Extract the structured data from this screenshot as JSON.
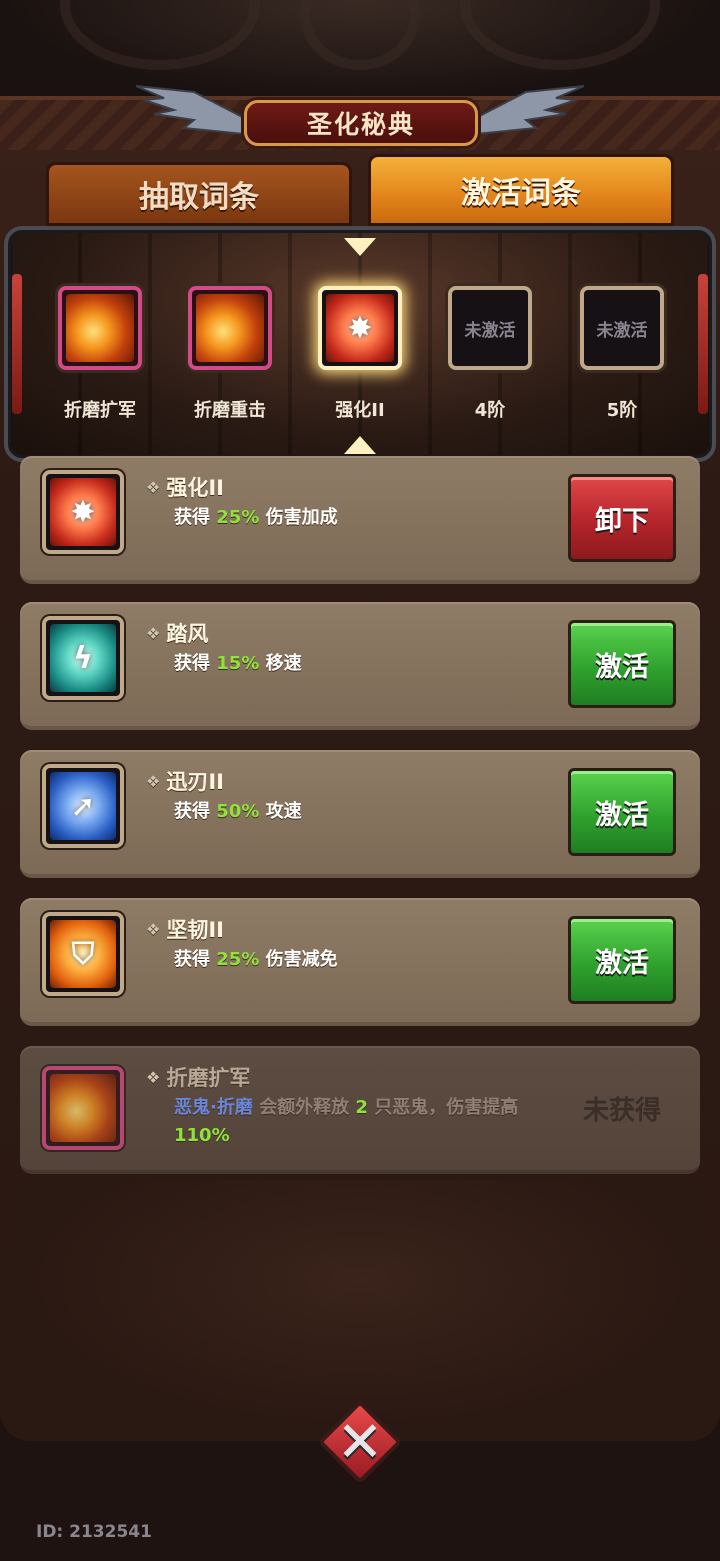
{
  "header": {
    "title": "圣化秘典"
  },
  "tabs": [
    {
      "label": "抽取词条",
      "active": false
    },
    {
      "label": "激活词条",
      "active": true
    }
  ],
  "slots": [
    {
      "label": "折磨扩军",
      "icon": "fire-fist-icon",
      "state": "equipped"
    },
    {
      "label": "折磨重击",
      "icon": "fire-fist-icon",
      "state": "equipped"
    },
    {
      "label": "强化II",
      "icon": "power-burst-icon",
      "state": "selected"
    },
    {
      "label": "4阶",
      "empty_text": "未激活",
      "state": "locked"
    },
    {
      "label": "5阶",
      "empty_text": "未激活",
      "state": "locked"
    }
  ],
  "cards": [
    {
      "name": "强化II",
      "desc_prefix": "获得",
      "value": "25%",
      "desc_suffix": "伤害加成",
      "icon": "power-burst-icon",
      "button": "卸下",
      "button_color": "red"
    },
    {
      "name": "踏风",
      "desc_prefix": "获得",
      "value": "15%",
      "desc_suffix": "移速",
      "icon": "wind-icon",
      "button": "激活",
      "button_color": "green"
    },
    {
      "name": "迅刃II",
      "desc_prefix": "获得",
      "value": "50%",
      "desc_suffix": "攻速",
      "icon": "blade-arrow-icon",
      "button": "激活",
      "button_color": "green"
    },
    {
      "name": "坚韧II",
      "desc_prefix": "获得",
      "value": "25%",
      "desc_suffix": "伤害减免",
      "icon": "star-shield-icon",
      "button": "激活",
      "button_color": "green"
    },
    {
      "name": "折磨扩军",
      "keyword": "恶鬼·折磨",
      "desc_part1": "会额外释放",
      "count": "2",
      "desc_part2": "只恶鬼，伤害提高",
      "value": "110%",
      "icon": "fire-fist-icon",
      "status": "未获得"
    }
  ],
  "footer": {
    "close_icon": "close-x-icon",
    "id_text": "ID: 2132541"
  },
  "colors": {
    "accent_green": "#8fe23a",
    "keyword_blue": "#6b86d8",
    "button_red": "#b4242a",
    "button_green": "#2fa22e",
    "tab_active": "#e2841a"
  }
}
